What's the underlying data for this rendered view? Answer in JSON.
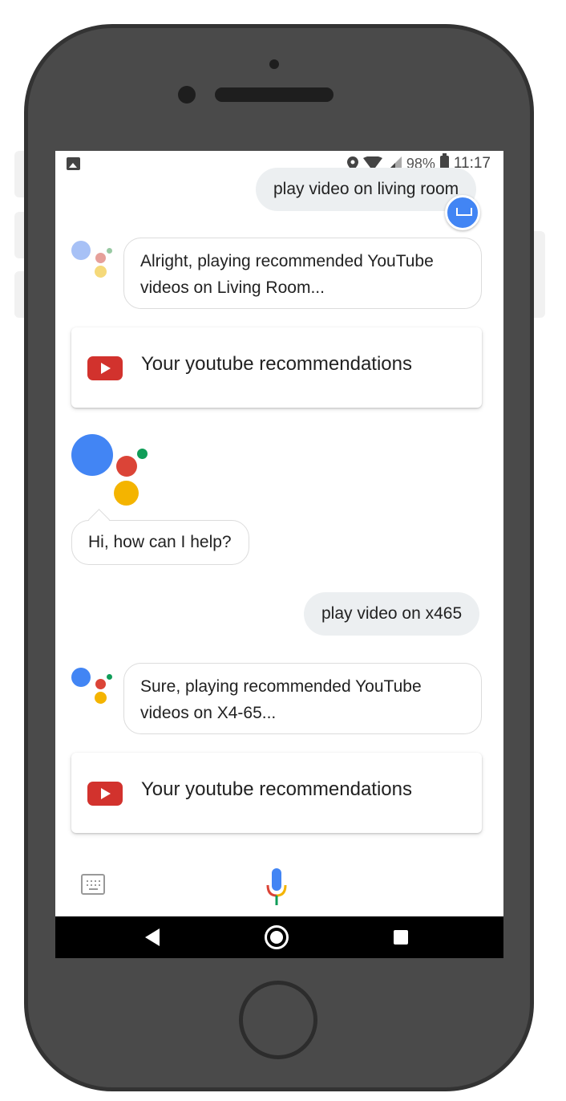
{
  "status_bar": {
    "battery": "98%",
    "time": "11:17"
  },
  "conversation": {
    "user_1": "play video on living room",
    "assistant_1": "Alright, playing recommended YouTube videos on Living Room...",
    "card_1": "Your youtube recommendations",
    "assistant_greeting": "Hi, how can I help?",
    "user_2": "play video on x465",
    "assistant_2": "Sure, playing recommended YouTube videos on X4-65...",
    "card_2": "Your youtube recommendations"
  },
  "icons": {
    "status_left": "image-icon",
    "status_right": [
      "location-icon",
      "wifi-icon",
      "signal-icon",
      "battery-icon"
    ],
    "fab": "keyboard-dismiss-icon",
    "card": "youtube-icon",
    "bottom_left": "keyboard-icon",
    "bottom_center": "mic-icon",
    "nav": [
      "back-icon",
      "home-icon",
      "recents-icon"
    ]
  },
  "colors": {
    "assistant_blue": "#4285f4",
    "assistant_red": "#db4437",
    "assistant_yellow": "#f4b400",
    "assistant_green": "#0f9d58",
    "youtube_red": "#d2322d",
    "user_bubble": "#eceff1"
  }
}
